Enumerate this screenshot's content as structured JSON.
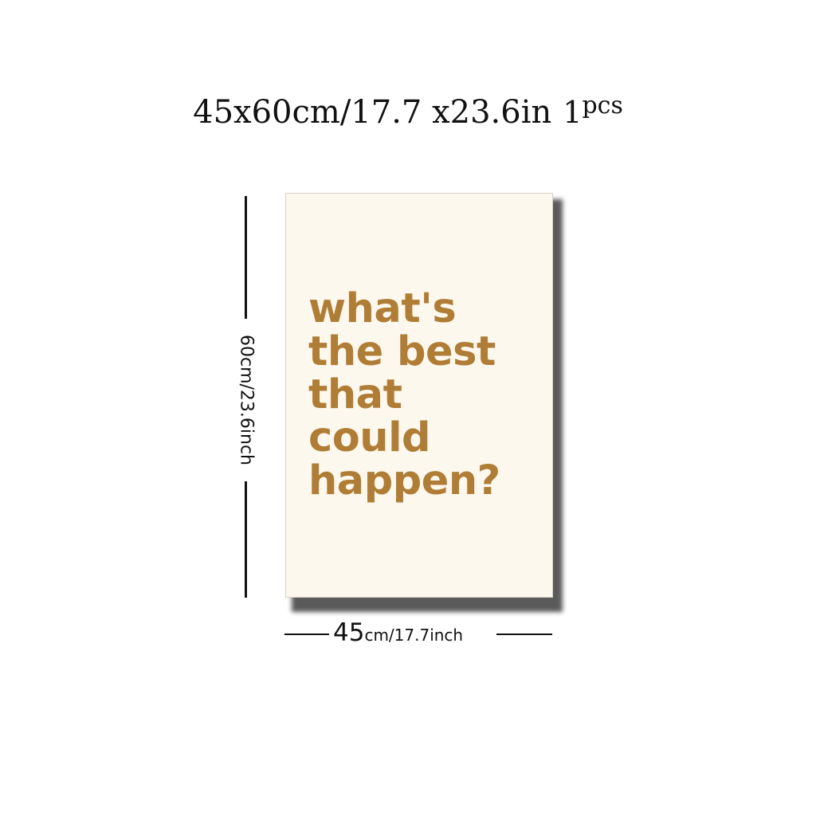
{
  "header": {
    "dimensions": "45x60cm/17.7 x23.6in",
    "quantity": "1",
    "quantity_unit": "pcs"
  },
  "poster": {
    "background_color": "#fdf8ed",
    "text_color": "#b07d36",
    "lines": [
      "what's",
      "the best",
      "that",
      "could",
      "happen?"
    ]
  },
  "height_label": "60cm/23.6inch",
  "width_label": {
    "number": "45",
    "rest": "cm/17.7inch"
  }
}
